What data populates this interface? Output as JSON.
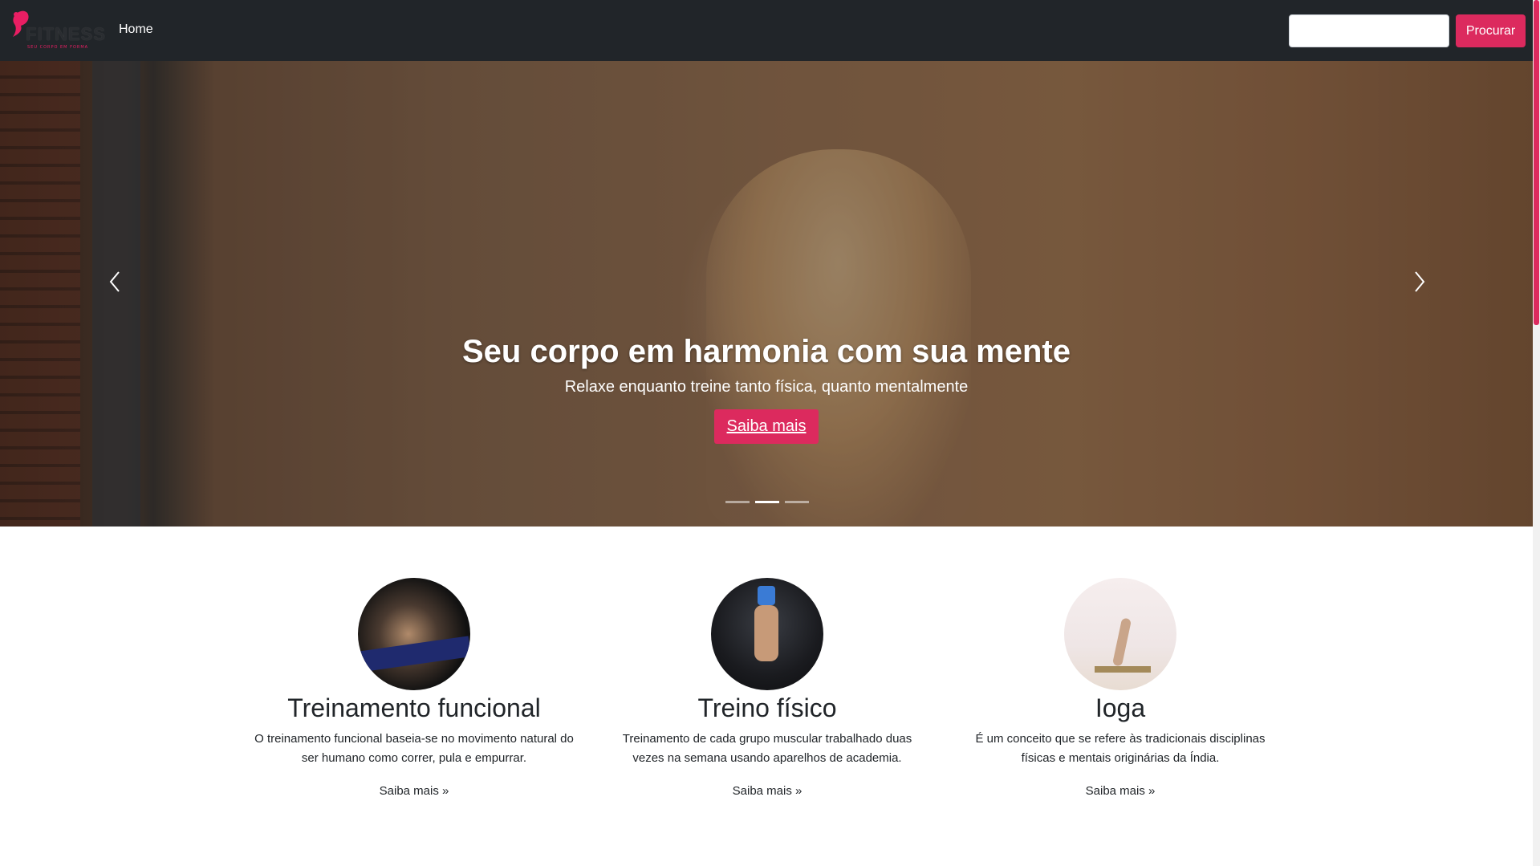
{
  "navbar": {
    "logo_text": "FITNESS",
    "logo_tagline": "SEU CORPO EM FORMA",
    "home_label": "Home",
    "search_placeholder": "",
    "search_button": "Procurar"
  },
  "carousel": {
    "title": "Seu corpo em harmonia com sua mente",
    "subtitle": "Relaxe enquanto treine tanto física, quanto mentalmente",
    "cta_label": "Saiba mais",
    "slide_count": 3,
    "active_slide": 1
  },
  "features": [
    {
      "title": "Treinamento funcional",
      "description": "O treinamento funcional baseia-se no movimento natural do ser humano como correr, pula e empurrar.",
      "link": "Saiba mais »"
    },
    {
      "title": "Treino físico",
      "description": "Treinamento de cada grupo muscular trabalhado duas vezes na semana usando aparelhos de academia.",
      "link": "Saiba mais »"
    },
    {
      "title": "Ioga",
      "description": "É um conceito que se refere às tradicionais disciplinas físicas e mentais originárias da Índia.",
      "link": "Saiba mais »"
    }
  ],
  "colors": {
    "accent": "#dc2a5e",
    "navbar_bg": "#212529"
  }
}
